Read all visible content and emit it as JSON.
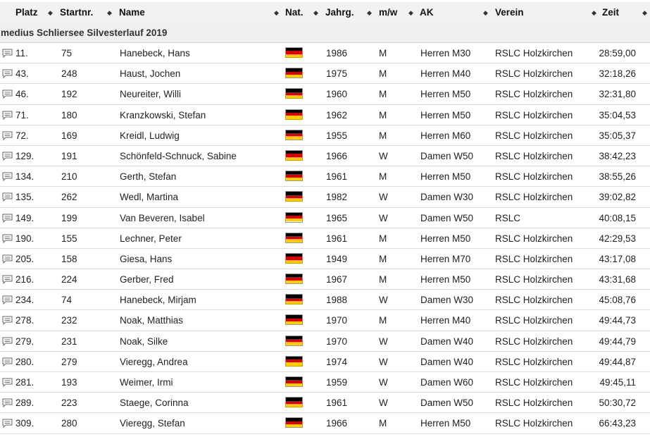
{
  "columns": {
    "platz": "Platz",
    "startnr": "Startnr.",
    "name": "Name",
    "nat": "Nat.",
    "jahrg": "Jahrg.",
    "mw": "m/w",
    "ak": "AK",
    "verein": "Verein",
    "zeit": "Zeit"
  },
  "event_title": "medius Schliersee Silvesterlauf 2019",
  "flag_colors": [
    "#000000",
    "#dd0000",
    "#ffce00"
  ],
  "rows": [
    {
      "platz": "11.",
      "startnr": "75",
      "name": "Hanebeck, Hans",
      "nat": "germany-flag-icon",
      "jahrg": "1986",
      "mw": "M",
      "ak": "Herren M30",
      "verein": "RSLC Holzkirchen",
      "zeit": "28:59,00"
    },
    {
      "platz": "43.",
      "startnr": "248",
      "name": "Haust, Jochen",
      "nat": "germany-flag-icon",
      "jahrg": "1975",
      "mw": "M",
      "ak": "Herren M40",
      "verein": "RSLC Holzkirchen",
      "zeit": "32:18,26"
    },
    {
      "platz": "46.",
      "startnr": "192",
      "name": "Neureiter, Willi",
      "nat": "germany-flag-icon",
      "jahrg": "1960",
      "mw": "M",
      "ak": "Herren M50",
      "verein": "RSLC Holzkirchen",
      "zeit": "32:31,80"
    },
    {
      "platz": "71.",
      "startnr": "180",
      "name": "Kranzkowski, Stefan",
      "nat": "germany-flag-icon",
      "jahrg": "1962",
      "mw": "M",
      "ak": "Herren M50",
      "verein": "RSLC Holzkirchen",
      "zeit": "35:04,53"
    },
    {
      "platz": "72.",
      "startnr": "169",
      "name": "Kreidl, Ludwig",
      "nat": "germany-flag-icon",
      "jahrg": "1955",
      "mw": "M",
      "ak": "Herren M60",
      "verein": "RSLC Holzkirchen",
      "zeit": "35:05,37"
    },
    {
      "platz": "129.",
      "startnr": "191",
      "name": "Schönfeld-Schnuck, Sabine",
      "nat": "germany-flag-icon",
      "jahrg": "1966",
      "mw": "W",
      "ak": "Damen W50",
      "verein": "RSLC Holzkirchen",
      "zeit": "38:42,23"
    },
    {
      "platz": "134.",
      "startnr": "210",
      "name": "Gerth, Stefan",
      "nat": "germany-flag-icon",
      "jahrg": "1961",
      "mw": "M",
      "ak": "Herren M50",
      "verein": "RSLC Holzkirchen",
      "zeit": "38:55,26"
    },
    {
      "platz": "135.",
      "startnr": "262",
      "name": "Wedl, Martina",
      "nat": "germany-flag-icon",
      "jahrg": "1982",
      "mw": "W",
      "ak": "Damen W30",
      "verein": "RSLC Holzkirchen",
      "zeit": "39:02,82"
    },
    {
      "platz": "149.",
      "startnr": "199",
      "name": "Van Beveren, Isabel",
      "nat": "germany-flag-icon",
      "jahrg": "1965",
      "mw": "W",
      "ak": "Damen W50",
      "verein": "RSLC",
      "zeit": "40:08,15"
    },
    {
      "platz": "190.",
      "startnr": "155",
      "name": "Lechner, Peter",
      "nat": "germany-flag-icon",
      "jahrg": "1961",
      "mw": "M",
      "ak": "Herren M50",
      "verein": "RSLC Holzkirchen",
      "zeit": "42:29,53"
    },
    {
      "platz": "205.",
      "startnr": "158",
      "name": "Giesa, Hans",
      "nat": "germany-flag-icon",
      "jahrg": "1949",
      "mw": "M",
      "ak": "Herren M70",
      "verein": "RSLC Holzkirchen",
      "zeit": "43:17,08"
    },
    {
      "platz": "216.",
      "startnr": "224",
      "name": "Gerber, Fred",
      "nat": "germany-flag-icon",
      "jahrg": "1967",
      "mw": "M",
      "ak": "Herren M50",
      "verein": "RSLC Holzkirchen",
      "zeit": "43:31,68"
    },
    {
      "platz": "234.",
      "startnr": "74",
      "name": "Hanebeck, Mirjam",
      "nat": "germany-flag-icon",
      "jahrg": "1988",
      "mw": "W",
      "ak": "Damen W30",
      "verein": "RSLC Holzkirchen",
      "zeit": "45:08,76"
    },
    {
      "platz": "278.",
      "startnr": "232",
      "name": "Noak, Matthias",
      "nat": "germany-flag-icon",
      "jahrg": "1970",
      "mw": "M",
      "ak": "Herren M40",
      "verein": "RSLC Holzkirchen",
      "zeit": "49:44,73"
    },
    {
      "platz": "279.",
      "startnr": "231",
      "name": "Noak, Silke",
      "nat": "germany-flag-icon",
      "jahrg": "1970",
      "mw": "W",
      "ak": "Damen W40",
      "verein": "RSLC Holzkirchen",
      "zeit": "49:44,79"
    },
    {
      "platz": "280.",
      "startnr": "279",
      "name": "Vieregg, Andrea",
      "nat": "germany-flag-icon",
      "jahrg": "1974",
      "mw": "W",
      "ak": "Damen W40",
      "verein": "RSLC Holzkirchen",
      "zeit": "49:44,87"
    },
    {
      "platz": "281.",
      "startnr": "193",
      "name": "Weimer, Irmi",
      "nat": "germany-flag-icon",
      "jahrg": "1959",
      "mw": "W",
      "ak": "Damen W60",
      "verein": "RSLC Holzkirchen",
      "zeit": "49:45,11"
    },
    {
      "platz": "289.",
      "startnr": "223",
      "name": "Staege, Corinna",
      "nat": "germany-flag-icon",
      "jahrg": "1961",
      "mw": "W",
      "ak": "Damen W50",
      "verein": "RSLC Holzkirchen",
      "zeit": "50:30,72"
    },
    {
      "platz": "309.",
      "startnr": "280",
      "name": "Vieregg, Stefan",
      "nat": "germany-flag-icon",
      "jahrg": "1966",
      "mw": "M",
      "ak": "Herren M50",
      "verein": "RSLC Holzkirchen",
      "zeit": "66:43,23"
    }
  ]
}
